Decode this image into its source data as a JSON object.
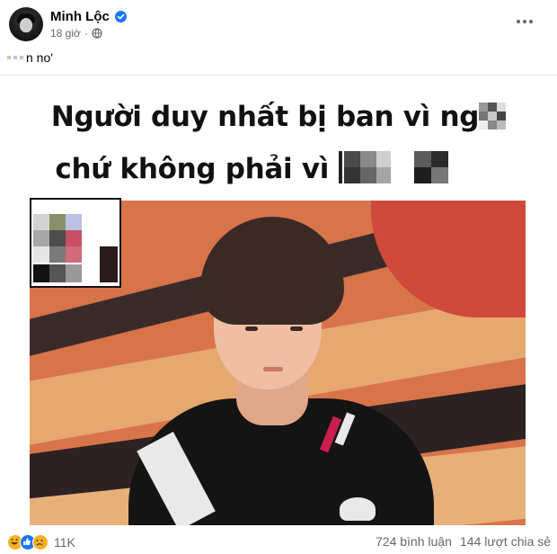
{
  "post": {
    "author": "Minh Lộc",
    "time": "18 giờ",
    "privacy_icon": "globe-icon",
    "verified_icon": "verified-badge-icon",
    "caption": "n no'",
    "image_text": {
      "line1": "Người duy nhất bị ban vì ng",
      "line2": "chứ không phải vì "
    }
  },
  "footer": {
    "reaction_icons": [
      "haha-icon",
      "like-icon",
      "sad-icon"
    ],
    "reaction_count": "11K",
    "comments": "724 bình luận",
    "shares": "144 lượt chia sẻ"
  },
  "colors": {
    "accent": "#1877f2",
    "secondary_text": "#65676b",
    "divider": "#e4e6eb"
  }
}
